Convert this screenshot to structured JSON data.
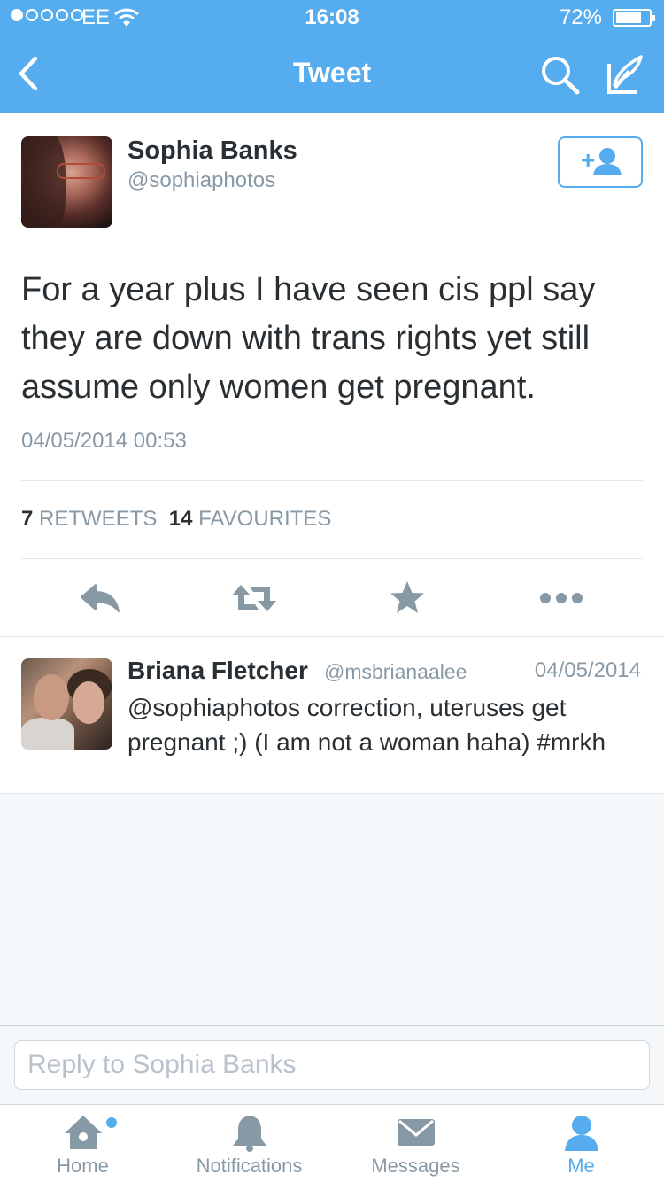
{
  "status_bar": {
    "carrier": "EE",
    "time": "16:08",
    "battery": "72%",
    "battery_level": 0.72,
    "signal_bars": 1
  },
  "nav": {
    "title": "Tweet",
    "back_icon": "chevron-left-icon",
    "search_icon": "search-icon",
    "compose_icon": "compose-tweet-icon"
  },
  "tweet": {
    "author_name": "Sophia Banks",
    "author_handle": "@sophiaphotos",
    "text": "For a year plus I have seen cis ppl say they are down with trans rights yet still assume only women get pregnant.",
    "timestamp": "04/05/2014 00:53",
    "retweet_count": "7",
    "retweet_label": "RETWEETS",
    "favourite_count": "14",
    "favourite_label": "FAVOURITES",
    "follow_icon": "add-user-icon",
    "actions": [
      {
        "icon": "reply-icon"
      },
      {
        "icon": "retweet-icon"
      },
      {
        "icon": "favourite-star-icon"
      },
      {
        "icon": "more-icon"
      }
    ]
  },
  "reply": {
    "author_name": "Briana Fletcher",
    "author_handle": "@msbrianaalee",
    "date": "04/05/2014",
    "text": "@sophiaphotos correction, uteruses get pregnant ;) (I am not a woman haha) #mrkh"
  },
  "reply_box": {
    "placeholder": "Reply to Sophia Banks"
  },
  "tabs": [
    {
      "label": "Home",
      "icon": "home-icon",
      "active": false,
      "has_dot": true
    },
    {
      "label": "Notifications",
      "icon": "bell-icon",
      "active": false
    },
    {
      "label": "Messages",
      "icon": "envelope-icon",
      "active": false
    },
    {
      "label": "Me",
      "icon": "person-icon",
      "active": true
    }
  ],
  "colors": {
    "brand": "#55acee",
    "text": "#292f33",
    "muted": "#8899a6",
    "icon_gray": "#8899a6"
  }
}
